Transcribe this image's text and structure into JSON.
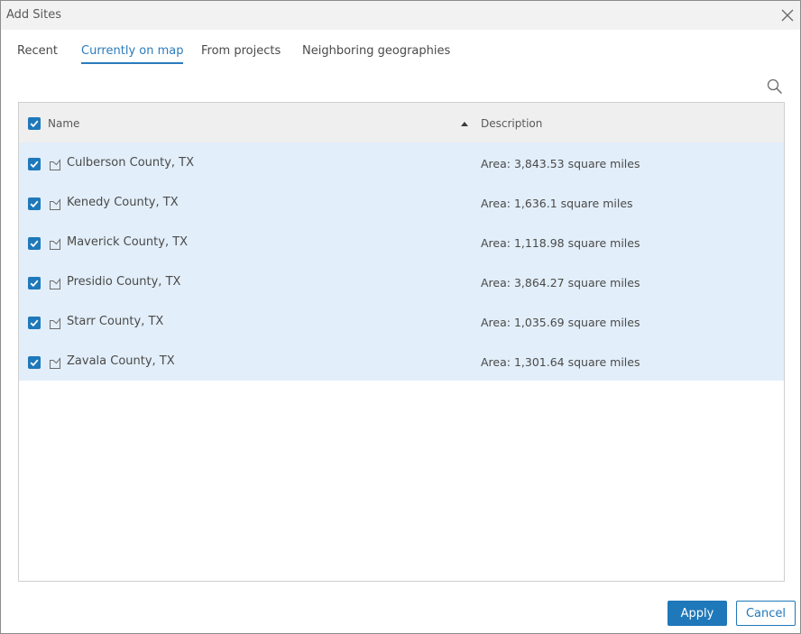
{
  "dialog": {
    "title": "Add Sites"
  },
  "tabs": [
    {
      "label": "Recent",
      "active": false
    },
    {
      "label": "Currently on map",
      "active": true
    },
    {
      "label": "From projects",
      "active": false
    },
    {
      "label": "Neighboring geographies",
      "active": false
    }
  ],
  "table": {
    "columns": {
      "name": "Name",
      "description": "Description"
    },
    "sort": "ascending",
    "select_all_checked": true,
    "rows": [
      {
        "name": "Culberson County, TX",
        "description": "Area: 3,843.53 square miles",
        "checked": true
      },
      {
        "name": "Kenedy County, TX",
        "description": "Area: 1,636.1 square miles",
        "checked": true
      },
      {
        "name": "Maverick County, TX",
        "description": "Area: 1,118.98 square miles",
        "checked": true
      },
      {
        "name": "Presidio County, TX",
        "description": "Area: 3,864.27 square miles",
        "checked": true
      },
      {
        "name": "Starr County, TX",
        "description": "Area: 1,035.69 square miles",
        "checked": true
      },
      {
        "name": "Zavala County, TX",
        "description": "Area: 1,301.64 square miles",
        "checked": true
      }
    ]
  },
  "footer": {
    "apply_label": "Apply",
    "cancel_label": "Cancel"
  },
  "icons": {
    "close": "close-icon",
    "search": "search-icon",
    "sort": "sort-ascending-icon",
    "row": "polygon-icon",
    "checkbox": "checkbox-checked-icon"
  },
  "colors": {
    "accent": "#1f78b9",
    "row_selected": "#e2eef9",
    "header_bg": "#efefef",
    "titlebar_bg": "#f2f2f2"
  }
}
